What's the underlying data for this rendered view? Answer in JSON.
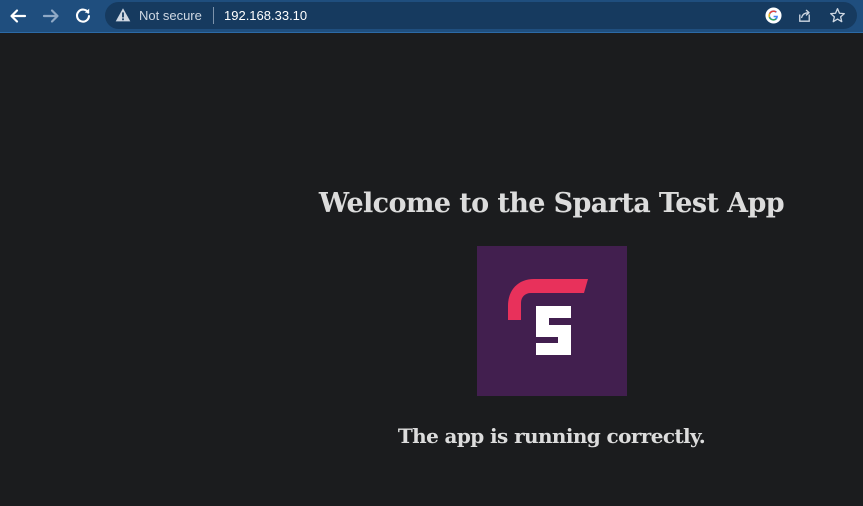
{
  "browser": {
    "security_label": "Not secure",
    "url": "192.168.33.10",
    "icons": {
      "back": "arrow-left-icon",
      "forward": "arrow-right-icon",
      "reload": "reload-icon",
      "warning": "warning-triangle-icon",
      "google": "google-icon",
      "share": "share-icon",
      "bookmark": "star-icon"
    },
    "colors": {
      "toolbar": "#1f4e7e",
      "omnibox": "#163a5f"
    }
  },
  "page": {
    "heading": "Welcome to the Sparta Test App",
    "logo_letter": "S",
    "status": "The app is running correctly.",
    "colors": {
      "background": "#1b1c1e",
      "text": "#dcdcdc",
      "logo_tile": "#421f4f",
      "logo_accent": "#e8315b",
      "logo_letter": "#ffffff"
    }
  }
}
